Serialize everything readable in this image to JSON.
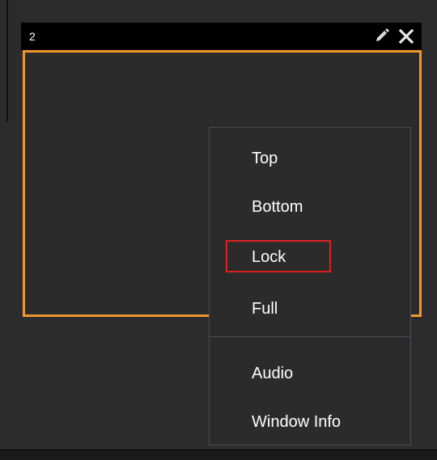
{
  "window": {
    "number": "2",
    "edit_icon": "pencil-icon",
    "close_icon": "close-icon",
    "border_color": "#f0962f"
  },
  "context_menu": {
    "items": [
      {
        "label": "Top"
      },
      {
        "label": "Bottom"
      },
      {
        "label": "Lock"
      },
      {
        "label": "Full"
      },
      {
        "label": "Audio"
      },
      {
        "label": "Window Info"
      }
    ],
    "highlighted_item": "Lock",
    "highlight_color": "#e02020"
  }
}
